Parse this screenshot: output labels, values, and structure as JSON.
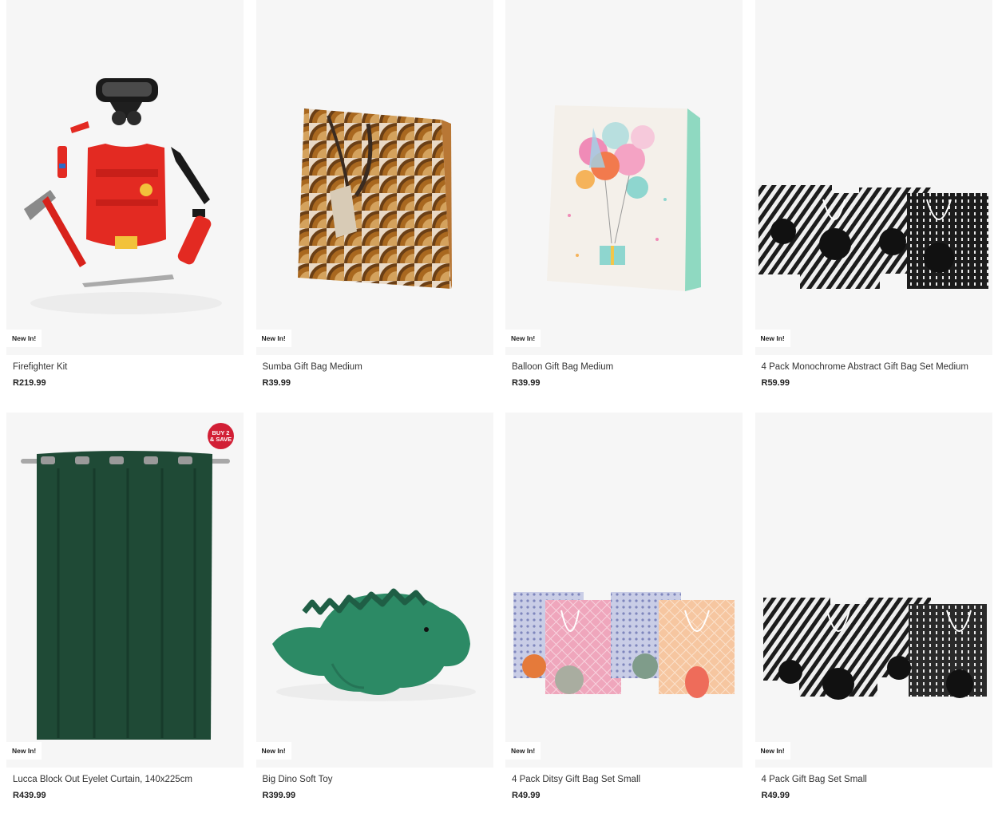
{
  "products": [
    {
      "name": "Firefighter Kit",
      "price": "R219.99",
      "badge": "New In!",
      "image": "firefighter-kit-image"
    },
    {
      "name": "Sumba Gift Bag Medium",
      "price": "R39.99",
      "badge": "New In!",
      "image": "sumba-gift-bag-image"
    },
    {
      "name": "Balloon Gift Bag Medium",
      "price": "R39.99",
      "badge": "New In!",
      "image": "balloon-gift-bag-image"
    },
    {
      "name": "4 Pack Monochrome Abstract Gift Bag Set Medium",
      "price": "R59.99",
      "badge": "New In!",
      "image": "monochrome-gift-bag-set-image"
    },
    {
      "name": "Lucca Block Out Eyelet Curtain, 140x225cm",
      "price": "R439.99",
      "badge": "New In!",
      "image": "green-curtain-image",
      "promo": {
        "line1": "BUY 2",
        "line2": "& SAVE"
      }
    },
    {
      "name": "Big Dino Soft Toy",
      "price": "R399.99",
      "badge": "New In!",
      "image": "dino-soft-toy-image"
    },
    {
      "name": "4 Pack Ditsy Gift Bag Set Small",
      "price": "R49.99",
      "badge": "New In!",
      "image": "ditsy-gift-bag-set-image"
    },
    {
      "name": "4 Pack Gift Bag Set Small",
      "price": "R49.99",
      "badge": "New In!",
      "image": "gift-bag-set-small-image"
    }
  ],
  "colors": {
    "promo": "#d21f35",
    "image_bg": "#f6f6f6"
  }
}
